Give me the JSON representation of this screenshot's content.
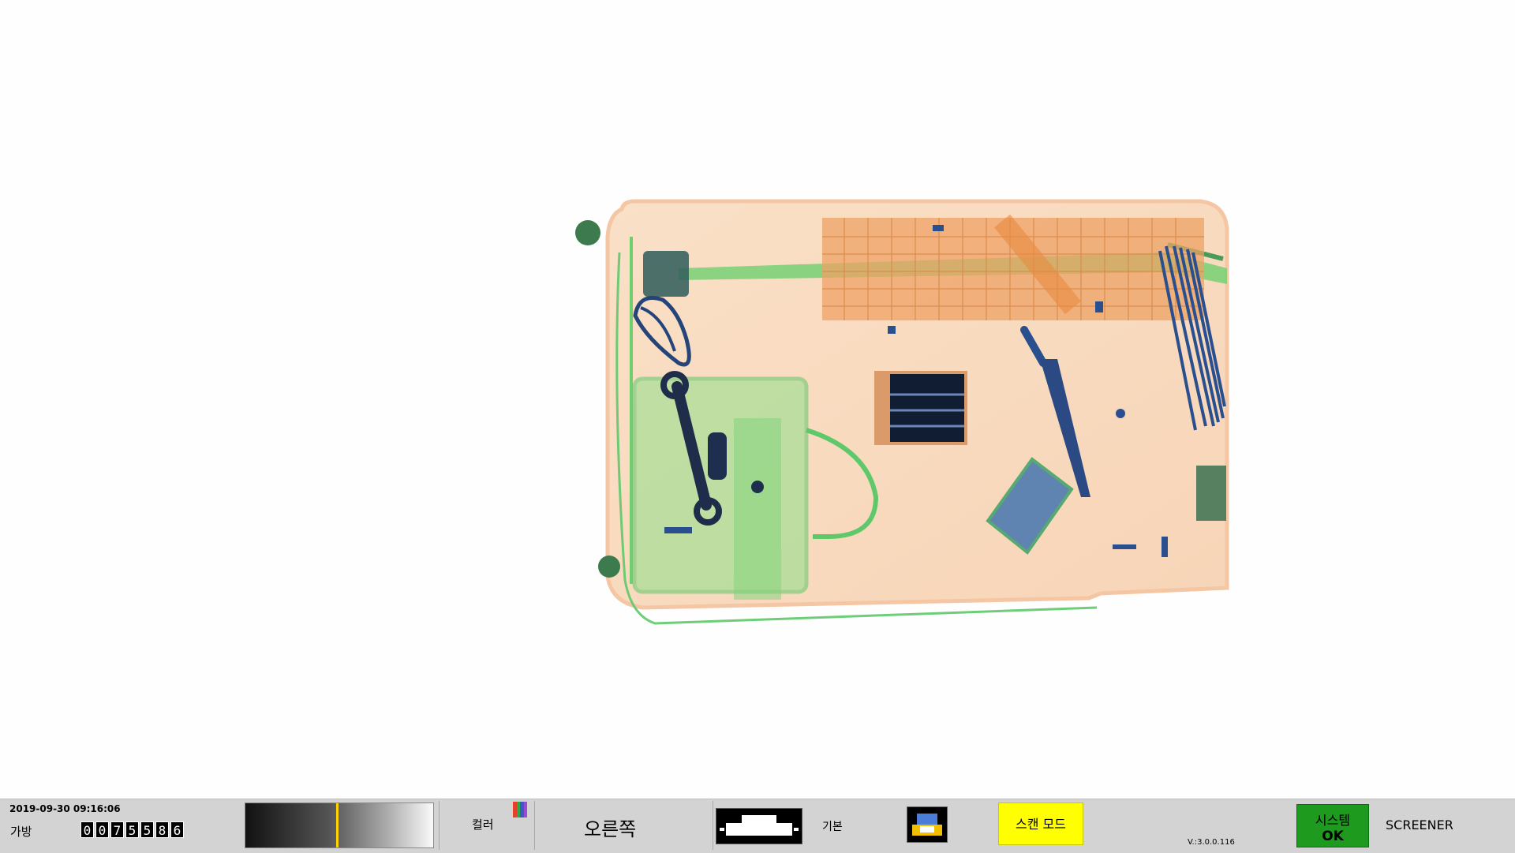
{
  "status_bar": {
    "datetime": "2019-09-30 09:16:06",
    "bag_label": "가방",
    "bag_count_digits": [
      "0",
      "0",
      "7",
      "5",
      "5",
      "8",
      "6"
    ],
    "gray_level_fraction": 0.49,
    "color_label": "컬러",
    "color_swatch": [
      "#e8402a",
      "#2aa84a",
      "#3e58c8",
      "#9a4bd0"
    ],
    "direction_label": "오른쪽",
    "default_label": "기본",
    "scan_mode_label": "스캔 모드",
    "version": "V.:3.0.0.116",
    "system_label": "시스템",
    "system_state": "OK",
    "user_role": "SCREENER"
  },
  "colors": {
    "xray_organic": "#f0a060",
    "xray_mixed": "#6fcf6f",
    "xray_metal": "#2a4f8f",
    "scan_mode_bg": "#ffff00",
    "system_ok_bg": "#1e9a1e"
  },
  "icons": {
    "conveyor": "conveyor-belt-icon",
    "threat": "threat-image-projection-icon",
    "color": "color-swatch-icon"
  }
}
